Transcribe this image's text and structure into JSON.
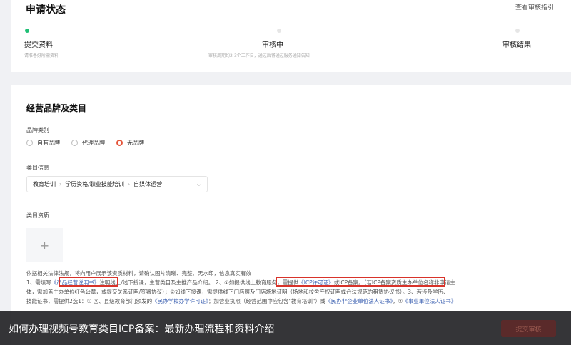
{
  "status": {
    "title": "申请状态",
    "guide_link": "查看审核指引",
    "steps": [
      {
        "label": "提交资料",
        "desc": "请准备好所需资料"
      },
      {
        "label": "审核中",
        "desc": "审核周期约2-3个工作日，通过后将通过服务通知告知"
      },
      {
        "label": "审核结果",
        "desc": ""
      }
    ]
  },
  "brand": {
    "section_title": "经营品牌及类目",
    "brand_type_label": "品牌类别",
    "options": [
      "自有品牌",
      "代理品牌",
      "无品牌"
    ],
    "selected": "无品牌",
    "category_label": "类目信息",
    "category_path": [
      "教育培训",
      "学历资格/职业技能培训",
      "自媒体运营"
    ],
    "qualification_label": "类目资质",
    "upload_plus": "+",
    "notice": {
      "intro": "依据相关法律法规，将向用户展示该资质材料，请确认图片清晰、完整、无水印，信息真实有效",
      "line1_a": "1、需填写",
      "line1_link": "《产品经营说明书》",
      "line1_b": "注明线上/线下授课，主营类目及主推产品介绍。",
      "line1_c": "2、①如提供线上教育服务，需提供",
      "line1_link2": "《ICP许可证》",
      "line1_d": "或ICP备案。（若ICP备案资质主办单位名称非申请主",
      "line2": "体，需加盖主办单位红色公章，或提交关系证明/签署协议）；②如线下授课，需提供线下门店照及门店场地证明（场地和校舍产权证明或合法规范的租赁协议书）。3、若涉及学历、",
      "line3_a": "技能证书，需提供2选1：① 区、县级教育部门颁发的",
      "line3_link": "《民办学校办学许可证》",
      "line3_b": "；加营业执照（经营范围中应包含\"教育培训\"）或",
      "line3_link2": "《民办非企业单位法人证书》",
      "line3_c": "，②",
      "line3_link3": "《事业单位法人证书》"
    }
  },
  "footer": {
    "caption": "如何办理视频号教育类目ICP备案：最新办理流程和资料介绍",
    "submit_label": "提交审核"
  },
  "colors": {
    "accent": "#e5553a",
    "progress": "#1fbf75",
    "link": "#3a5fb0",
    "highlight": "#d8332a"
  }
}
